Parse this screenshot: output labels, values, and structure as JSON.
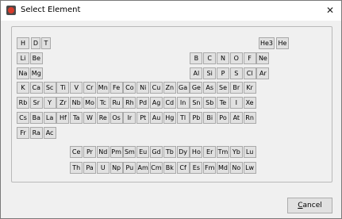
{
  "window": {
    "title": "Select Element"
  },
  "footer": {
    "cancel_label": "Cancel",
    "cancel_mnemonic": "C",
    "cancel_rest": "ancel"
  },
  "rows": [
    [
      "H",
      "D",
      "T",
      "He3",
      "He"
    ],
    [
      "Li",
      "Be",
      "B",
      "C",
      "N",
      "O",
      "F",
      "Ne"
    ],
    [
      "Na",
      "Mg",
      "Al",
      "Si",
      "P",
      "S",
      "Cl",
      "Ar"
    ],
    [
      "K",
      "Ca",
      "Sc",
      "Ti",
      "V",
      "Cr",
      "Mn",
      "Fe",
      "Co",
      "Ni",
      "Cu",
      "Zn",
      "Ga",
      "Ge",
      "As",
      "Se",
      "Br",
      "Kr"
    ],
    [
      "Rb",
      "Sr",
      "Y",
      "Zr",
      "Nb",
      "Mo",
      "Tc",
      "Ru",
      "Rh",
      "Pd",
      "Ag",
      "Cd",
      "In",
      "Sn",
      "Sb",
      "Te",
      "I",
      "Xe"
    ],
    [
      "Cs",
      "Ba",
      "La",
      "Hf",
      "Ta",
      "W",
      "Re",
      "Os",
      "Ir",
      "Pt",
      "Au",
      "Hg",
      "Tl",
      "Pb",
      "Bi",
      "Po",
      "At",
      "Rn"
    ],
    [
      "Fr",
      "Ra",
      "Ac"
    ],
    [
      "Ce",
      "Pr",
      "Nd",
      "Pm",
      "Sm",
      "Eu",
      "Gd",
      "Tb",
      "Dy",
      "Ho",
      "Er",
      "Tm",
      "Yb",
      "Lu"
    ],
    [
      "Th",
      "Pa",
      "U",
      "Np",
      "Pu",
      "Am",
      "Cm",
      "Bk",
      "Cf",
      "Es",
      "Fm",
      "Md",
      "No",
      "Lw"
    ]
  ]
}
